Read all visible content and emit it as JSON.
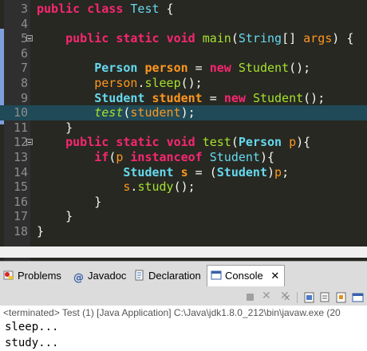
{
  "editor": {
    "lines": [
      {
        "n": "3",
        "fold": false,
        "hl": false,
        "tokens": [
          [
            "kw",
            "public "
          ],
          [
            "kw",
            "class "
          ],
          [
            "ty",
            "Test"
          ],
          [
            "pun",
            " {"
          ]
        ]
      },
      {
        "n": "4",
        "fold": false,
        "hl": false,
        "tokens": []
      },
      {
        "n": "5",
        "fold": true,
        "hl": false,
        "tokens": [
          [
            "pun",
            "    "
          ],
          [
            "kw",
            "public "
          ],
          [
            "kw",
            "static "
          ],
          [
            "kw",
            "void "
          ],
          [
            "fn",
            "main"
          ],
          [
            "pun",
            "("
          ],
          [
            "ty",
            "String"
          ],
          [
            "pun",
            "[] "
          ],
          [
            "prm",
            "args"
          ],
          [
            "pun",
            ") {"
          ]
        ]
      },
      {
        "n": "6",
        "fold": false,
        "hl": false,
        "tokens": []
      },
      {
        "n": "7",
        "fold": false,
        "hl": false,
        "tokens": [
          [
            "pun",
            "        "
          ],
          [
            "tyb",
            "Person "
          ],
          [
            "var",
            "person"
          ],
          [
            "pun",
            " = "
          ],
          [
            "kw",
            "new "
          ],
          [
            "fn",
            "Student"
          ],
          [
            "pun",
            "();"
          ]
        ]
      },
      {
        "n": "8",
        "fold": false,
        "hl": false,
        "tokens": [
          [
            "pun",
            "        "
          ],
          [
            "prm",
            "person"
          ],
          [
            "pun",
            "."
          ],
          [
            "fn",
            "sleep"
          ],
          [
            "pun",
            "();"
          ]
        ]
      },
      {
        "n": "9",
        "fold": false,
        "hl": false,
        "tokens": [
          [
            "pun",
            "        "
          ],
          [
            "tyb",
            "Student "
          ],
          [
            "var",
            "student"
          ],
          [
            "pun",
            " = "
          ],
          [
            "kw",
            "new "
          ],
          [
            "fn",
            "Student"
          ],
          [
            "pun",
            "();"
          ]
        ]
      },
      {
        "n": "10",
        "fold": false,
        "hl": true,
        "tokens": [
          [
            "pun",
            "        "
          ],
          [
            "ital",
            "test"
          ],
          [
            "pun",
            "("
          ],
          [
            "prm",
            "student"
          ],
          [
            "pun",
            ");"
          ]
        ]
      },
      {
        "n": "11",
        "fold": false,
        "hl": false,
        "tokens": [
          [
            "pun",
            "    }"
          ]
        ]
      },
      {
        "n": "12",
        "fold": true,
        "hl": false,
        "tokens": [
          [
            "pun",
            "    "
          ],
          [
            "kw",
            "public "
          ],
          [
            "kw",
            "static "
          ],
          [
            "kw",
            "void "
          ],
          [
            "fn",
            "test"
          ],
          [
            "pun",
            "("
          ],
          [
            "tyb",
            "Person "
          ],
          [
            "prm",
            "p"
          ],
          [
            "pun",
            "){"
          ]
        ]
      },
      {
        "n": "13",
        "fold": false,
        "hl": false,
        "tokens": [
          [
            "pun",
            "        "
          ],
          [
            "kw",
            "if"
          ],
          [
            "pun",
            "("
          ],
          [
            "prm",
            "p "
          ],
          [
            "kw",
            "instanceof "
          ],
          [
            "ty",
            "Student"
          ],
          [
            "pun",
            "){"
          ]
        ]
      },
      {
        "n": "14",
        "fold": false,
        "hl": false,
        "tokens": [
          [
            "pun",
            "            "
          ],
          [
            "tyb",
            "Student "
          ],
          [
            "var",
            "s"
          ],
          [
            "pun",
            " = ("
          ],
          [
            "tyb",
            "Student"
          ],
          [
            "pun",
            ")"
          ],
          [
            "prm",
            "p"
          ],
          [
            "pun",
            ";"
          ]
        ]
      },
      {
        "n": "15",
        "fold": false,
        "hl": false,
        "tokens": [
          [
            "pun",
            "            "
          ],
          [
            "prm",
            "s"
          ],
          [
            "pun",
            "."
          ],
          [
            "fn",
            "study"
          ],
          [
            "pun",
            "();"
          ]
        ]
      },
      {
        "n": "16",
        "fold": false,
        "hl": false,
        "tokens": [
          [
            "pun",
            "        }"
          ]
        ]
      },
      {
        "n": "17",
        "fold": false,
        "hl": false,
        "tokens": [
          [
            "pun",
            "    }"
          ]
        ]
      },
      {
        "n": "18",
        "fold": false,
        "hl": false,
        "tokens": [
          [
            "pun",
            "}"
          ]
        ]
      }
    ]
  },
  "tabs": [
    {
      "label": "Problems",
      "icon": "problems-icon"
    },
    {
      "label": "Javadoc",
      "icon": "javadoc-icon"
    },
    {
      "label": "Declaration",
      "icon": "declaration-icon"
    },
    {
      "label": "Console",
      "icon": "console-icon",
      "active": true
    }
  ],
  "console": {
    "terminated": "<terminated> Test (1) [Java Application] C:\\Java\\jdk1.8.0_212\\bin\\javaw.exe (20",
    "output": [
      "sleep...",
      "study..."
    ]
  },
  "toolbar_icons": [
    "terminate-icon",
    "remove-launch-icon",
    "remove-all-icon",
    "scroll-lock-icon",
    "copy-icon",
    "pin-icon",
    "display-console-icon"
  ],
  "colors": {
    "editor_bg": "#272822",
    "highlight": "#204a57",
    "keyword": "#f92672",
    "type": "#66d9ef",
    "function": "#a6e22e",
    "variable": "#fd971f"
  }
}
